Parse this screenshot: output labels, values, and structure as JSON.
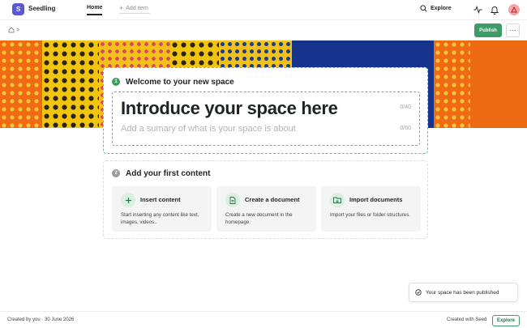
{
  "app": {
    "logo_letter": "S",
    "name": "Seedling"
  },
  "nav": {
    "home": "Home",
    "add_item": "Add item"
  },
  "header": {
    "explore": "Explore"
  },
  "breadcrumb": {
    "separator": ">"
  },
  "actions": {
    "publish": "Publish",
    "more": "···"
  },
  "welcome": {
    "step": "1",
    "title": "Welcome to your new space",
    "intro_placeholder": "Introduce your space here",
    "intro_count": "0/40",
    "summary_placeholder": "Add a sumary of what is your space is about",
    "summary_count": "0/60"
  },
  "content": {
    "step": "2",
    "title": "Add your first content",
    "options": [
      {
        "title": "Insert content",
        "desc": "Start inserting any content like text, images, videos..",
        "icon": "plus-icon"
      },
      {
        "title": "Create a document",
        "desc": "Create a new document in the homepage.",
        "icon": "document-icon"
      },
      {
        "title": "Import documents",
        "desc": "Import your files or folder structures.",
        "icon": "folder-import-icon"
      }
    ]
  },
  "toast": {
    "message": "Your space has been published"
  },
  "footer": {
    "created_by": "Created by you · 30 June 2026",
    "created_with": "Created with Seed",
    "explore": "Explore"
  },
  "colors": {
    "accent": "#3f9c66",
    "brand": "#5a57d8",
    "banner_orange": "#ee6a12",
    "banner_navy": "#16348c"
  }
}
